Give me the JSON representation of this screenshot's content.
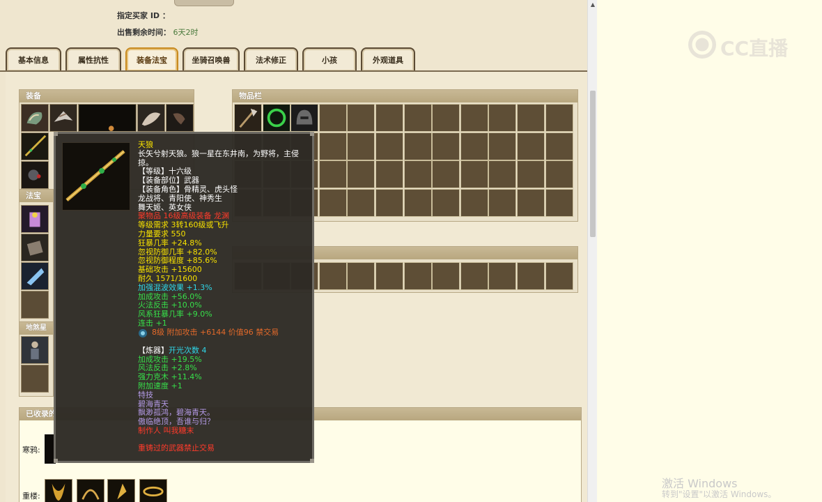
{
  "header": {
    "buyer_id_label": "指定买家 ID ：",
    "time_left_label": "出售剩余时间：",
    "time_left_value": "6天2时"
  },
  "tabs": [
    {
      "label": "基本信息",
      "active": false
    },
    {
      "label": "属性抗性",
      "active": false
    },
    {
      "label": "装备法宝",
      "active": true
    },
    {
      "label": "坐骑召唤兽",
      "active": false
    },
    {
      "label": "法术修正",
      "active": false
    },
    {
      "label": "小孩",
      "active": false
    },
    {
      "label": "外观道具",
      "active": false
    }
  ],
  "panels": {
    "equip_title": "装备",
    "fabao_title": "法宝",
    "dishazhi_title": "地煞星局",
    "inventory_title": "物品栏",
    "collection_title": "已收录的",
    "row_label_1": "寒鸦:",
    "row_label_2": "重楼:"
  },
  "tooltip": {
    "name": "天狼",
    "desc_1": "长矢兮射天狼。狼一星在东井南，为野将，主侵",
    "desc_2": "掠。",
    "level": "【等级】十六级",
    "slot": "【装备部位】武器",
    "roles_1": "【装备角色】骨精灵、虎头怪",
    "roles_2": "龙战将、青阳使、神秀生",
    "roles_3": "舞天姬、英女侠",
    "quality": "聚物品 16级高级装备 龙渊",
    "req_level": "等级需求 3转160级或飞升",
    "req_str": "力量要求 550",
    "stat_1": "狂暴几率 +24.8%",
    "stat_2": "忽视防御几率 +82.0%",
    "stat_3": "忽视防御程度 +85.6%",
    "stat_4": "基础攻击 +15600",
    "stat_5": "耐久 1571/1600",
    "stat_6": "加强混波效果 +1.3%",
    "stat_7": "加成攻击 +56.0%",
    "stat_8": "火法反击 +10.0%",
    "stat_9": "风系狂暴几率 +9.0%",
    "stat_10": "连击 +1",
    "gem_line": "8级 附加攻击 +6144 价值96 禁交易",
    "refine_label": "【炼器】",
    "refine_count": "开光次数 4",
    "ref_1": "加成攻击 +19.5%",
    "ref_2": "风法反击 +2.8%",
    "ref_3": "强力克木 +11.4%",
    "ref_4": "附加速度 +1",
    "special_label": "特技",
    "special_name": "碧海青天",
    "poem_1": "飘渺孤鸿，碧海青天。",
    "poem_2": "傲临绝顶，吾谁与归？",
    "maker": "制作人 叫我糖末",
    "forbid": "重铸过的武器禁止交易"
  },
  "watermark": {
    "line1": "激活 Windows",
    "line2": "转到\"设置\"以激活 Windows。",
    "brand": "CC直播"
  },
  "colors": {
    "tooltip_bg": "#2d2a24",
    "name_yellow": "#f7e100",
    "stat_green": "#37e04a",
    "stat_cyan": "#2fd6e8",
    "warn_red": "#ff3b2b",
    "poem_purple": "#b49ae6",
    "tab_active_border": "#c88a1f"
  }
}
